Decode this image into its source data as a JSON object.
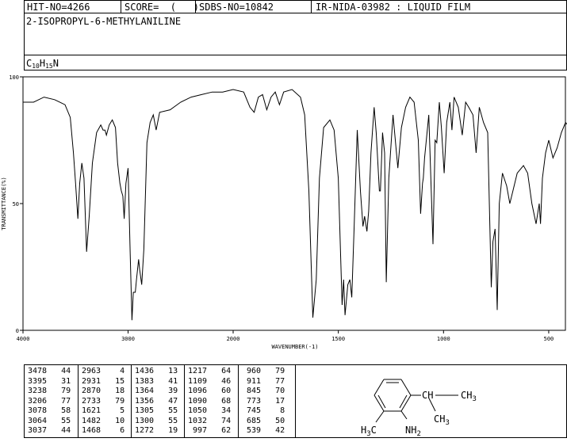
{
  "header": {
    "hit_no": "HIT-NO=4266",
    "score": "SCORE=  (   )",
    "sdbs_no": "SDBS-NO=10842",
    "ir_no": "IR-NIDA-03982 : LIQUID FILM"
  },
  "compound": {
    "name": "2-ISOPROPYL-6-METHYLANILINE",
    "formula": {
      "c": "C",
      "c_n": "10",
      "h": "H",
      "h_n": "15",
      "n": "N"
    }
  },
  "chart_data": {
    "type": "line",
    "xlabel": "WAVENUMBER(-1)",
    "ylabel": "TRANSMITTANCE(%)",
    "xlim": [
      4000,
      400
    ],
    "ylim": [
      0,
      100
    ],
    "x_ticks": [
      4000,
      3000,
      2000,
      1500,
      1000,
      500
    ],
    "y_ticks": [
      0,
      50,
      100
    ],
    "grid": false,
    "spectrum": [
      [
        4000,
        90
      ],
      [
        3900,
        90
      ],
      [
        3800,
        92
      ],
      [
        3700,
        91
      ],
      [
        3600,
        89
      ],
      [
        3550,
        84
      ],
      [
        3520,
        70
      ],
      [
        3500,
        58
      ],
      [
        3478,
        44
      ],
      [
        3460,
        58
      ],
      [
        3440,
        66
      ],
      [
        3420,
        60
      ],
      [
        3395,
        31
      ],
      [
        3370,
        45
      ],
      [
        3340,
        66
      ],
      [
        3300,
        78
      ],
      [
        3260,
        81
      ],
      [
        3238,
        79
      ],
      [
        3220,
        79
      ],
      [
        3206,
        77
      ],
      [
        3180,
        81
      ],
      [
        3150,
        83
      ],
      [
        3120,
        80
      ],
      [
        3100,
        66
      ],
      [
        3078,
        58
      ],
      [
        3064,
        55
      ],
      [
        3050,
        53
      ],
      [
        3037,
        44
      ],
      [
        3020,
        58
      ],
      [
        3000,
        64
      ],
      [
        2980,
        30
      ],
      [
        2963,
        4
      ],
      [
        2950,
        15
      ],
      [
        2931,
        15
      ],
      [
        2920,
        20
      ],
      [
        2900,
        28
      ],
      [
        2890,
        24
      ],
      [
        2870,
        18
      ],
      [
        2850,
        32
      ],
      [
        2820,
        74
      ],
      [
        2790,
        82
      ],
      [
        2760,
        85
      ],
      [
        2733,
        79
      ],
      [
        2700,
        86
      ],
      [
        2600,
        87
      ],
      [
        2500,
        90
      ],
      [
        2400,
        92
      ],
      [
        2300,
        93
      ],
      [
        2200,
        94
      ],
      [
        2100,
        94
      ],
      [
        2000,
        95
      ],
      [
        1950,
        94
      ],
      [
        1920,
        88
      ],
      [
        1900,
        86
      ],
      [
        1880,
        92
      ],
      [
        1860,
        93
      ],
      [
        1840,
        87
      ],
      [
        1820,
        92
      ],
      [
        1800,
        94
      ],
      [
        1780,
        89
      ],
      [
        1760,
        94
      ],
      [
        1720,
        95
      ],
      [
        1680,
        92
      ],
      [
        1660,
        85
      ],
      [
        1640,
        55
      ],
      [
        1621,
        5
      ],
      [
        1605,
        20
      ],
      [
        1590,
        60
      ],
      [
        1570,
        80
      ],
      [
        1540,
        83
      ],
      [
        1520,
        79
      ],
      [
        1500,
        60
      ],
      [
        1482,
        10
      ],
      [
        1475,
        20
      ],
      [
        1468,
        6
      ],
      [
        1455,
        18
      ],
      [
        1445,
        20
      ],
      [
        1436,
        13
      ],
      [
        1425,
        40
      ],
      [
        1410,
        79
      ],
      [
        1395,
        55
      ],
      [
        1383,
        41
      ],
      [
        1375,
        45
      ],
      [
        1364,
        39
      ],
      [
        1356,
        47
      ],
      [
        1345,
        70
      ],
      [
        1330,
        88
      ],
      [
        1320,
        78
      ],
      [
        1305,
        55
      ],
      [
        1300,
        55
      ],
      [
        1290,
        78
      ],
      [
        1280,
        70
      ],
      [
        1272,
        19
      ],
      [
        1260,
        60
      ],
      [
        1240,
        85
      ],
      [
        1217,
        64
      ],
      [
        1200,
        80
      ],
      [
        1180,
        88
      ],
      [
        1160,
        92
      ],
      [
        1140,
        90
      ],
      [
        1120,
        75
      ],
      [
        1109,
        46
      ],
      [
        1100,
        58
      ],
      [
        1096,
        60
      ],
      [
        1090,
        68
      ],
      [
        1070,
        85
      ],
      [
        1050,
        34
      ],
      [
        1040,
        75
      ],
      [
        1032,
        74
      ],
      [
        1020,
        90
      ],
      [
        1010,
        80
      ],
      [
        997,
        62
      ],
      [
        985,
        82
      ],
      [
        970,
        90
      ],
      [
        960,
        79
      ],
      [
        950,
        92
      ],
      [
        930,
        88
      ],
      [
        911,
        77
      ],
      [
        895,
        90
      ],
      [
        880,
        88
      ],
      [
        860,
        85
      ],
      [
        845,
        70
      ],
      [
        830,
        88
      ],
      [
        810,
        82
      ],
      [
        790,
        78
      ],
      [
        773,
        17
      ],
      [
        765,
        35
      ],
      [
        755,
        40
      ],
      [
        745,
        8
      ],
      [
        735,
        50
      ],
      [
        720,
        62
      ],
      [
        700,
        57
      ],
      [
        685,
        50
      ],
      [
        670,
        55
      ],
      [
        650,
        62
      ],
      [
        620,
        65
      ],
      [
        600,
        62
      ],
      [
        580,
        50
      ],
      [
        560,
        42
      ],
      [
        545,
        50
      ],
      [
        539,
        42
      ],
      [
        530,
        60
      ],
      [
        515,
        70
      ],
      [
        500,
        75
      ],
      [
        480,
        68
      ],
      [
        460,
        72
      ],
      [
        440,
        78
      ],
      [
        420,
        82
      ],
      [
        400,
        80
      ]
    ]
  },
  "peaks": [
    [
      [
        3478,
        44
      ],
      [
        3395,
        31
      ],
      [
        3238,
        79
      ],
      [
        3206,
        77
      ],
      [
        3078,
        58
      ],
      [
        3064,
        55
      ],
      [
        3037,
        44
      ]
    ],
    [
      [
        2963,
        4
      ],
      [
        2931,
        15
      ],
      [
        2870,
        18
      ],
      [
        2733,
        79
      ],
      [
        1621,
        5
      ],
      [
        1482,
        10
      ],
      [
        1468,
        6
      ]
    ],
    [
      [
        1436,
        13
      ],
      [
        1383,
        41
      ],
      [
        1364,
        39
      ],
      [
        1356,
        47
      ],
      [
        1305,
        55
      ],
      [
        1300,
        55
      ],
      [
        1272,
        19
      ]
    ],
    [
      [
        1217,
        64
      ],
      [
        1109,
        46
      ],
      [
        1096,
        60
      ],
      [
        1090,
        68
      ],
      [
        1050,
        34
      ],
      [
        1032,
        74
      ],
      [
        997,
        62
      ]
    ],
    [
      [
        960,
        79
      ],
      [
        911,
        77
      ],
      [
        845,
        70
      ],
      [
        773,
        17
      ],
      [
        745,
        8
      ],
      [
        685,
        50
      ],
      [
        539,
        42
      ]
    ]
  ],
  "structure": {
    "label_ch": "CH",
    "label_ch3_right": "CH",
    "label_ch3_right_sub": "3",
    "label_ch3_bottom": "CH",
    "label_ch3_bottom_sub": "3",
    "label_h3c": "H",
    "label_h3c_sub": "3",
    "label_h3c_c": "C",
    "label_nh2": "NH",
    "label_nh2_sub": "2"
  }
}
